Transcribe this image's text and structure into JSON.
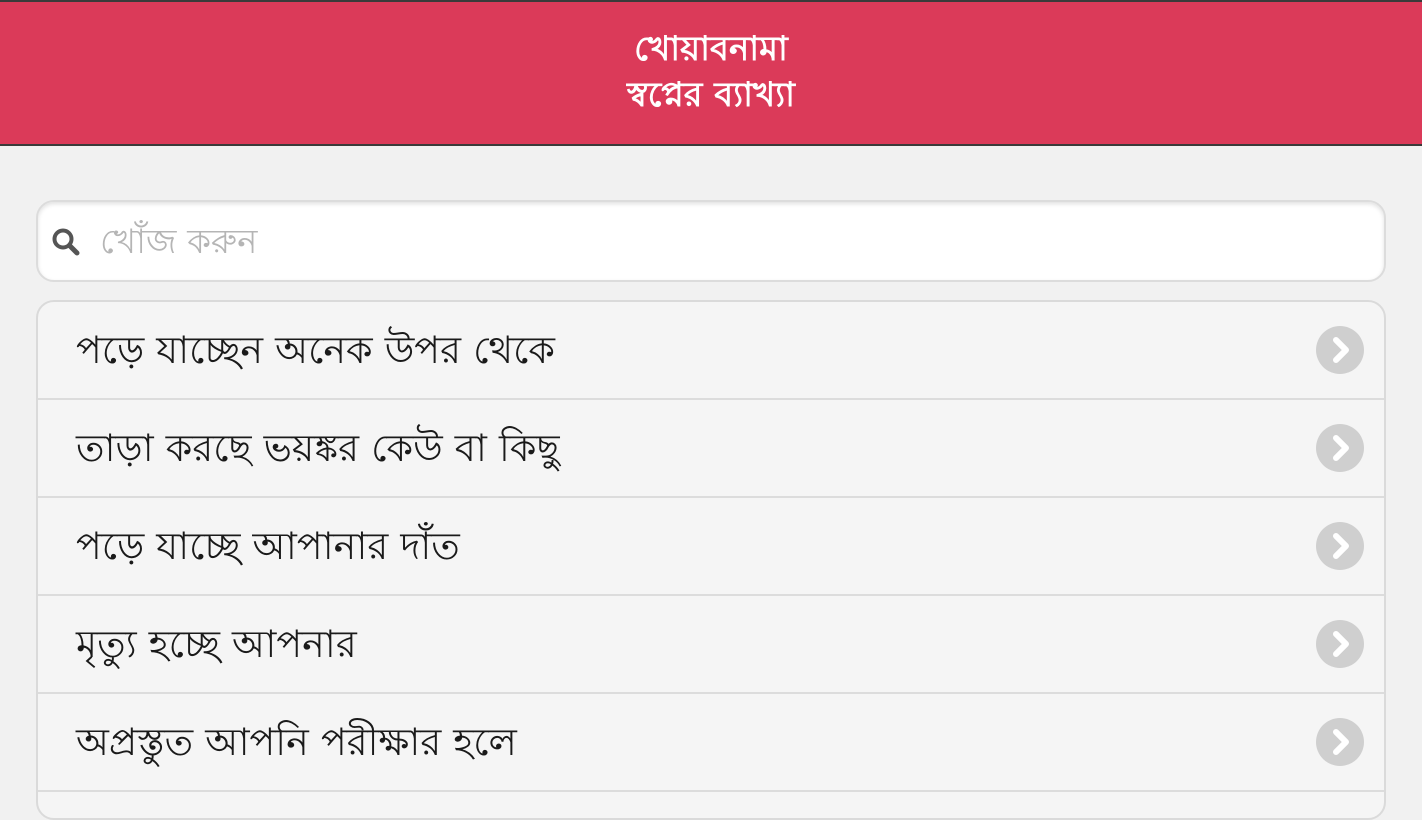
{
  "header": {
    "title_line1": "খোয়াবনামা",
    "title_line2": "স্বপ্নের ব্যাখ্যা"
  },
  "search": {
    "placeholder": "খোঁজ করুন",
    "value": ""
  },
  "list": {
    "items": [
      {
        "label": "পড়ে যাচ্ছেন অনেক উপর থেকে"
      },
      {
        "label": "তাড়া করছে ভয়ঙ্কর কেউ বা কিছু"
      },
      {
        "label": "পড়ে যাচ্ছে আপানার দাঁত"
      },
      {
        "label": "মৃত্যু হচ্ছে আপনার"
      },
      {
        "label": "অপ্রস্তুত আপনি পরীক্ষার হলে"
      }
    ]
  },
  "icons": {
    "search": "search-icon",
    "chevron": "chevron-right-icon"
  },
  "colors": {
    "header_bg": "#db3a59",
    "page_bg": "#f1f1f1",
    "chevron_bg": "#cfcfcf"
  }
}
